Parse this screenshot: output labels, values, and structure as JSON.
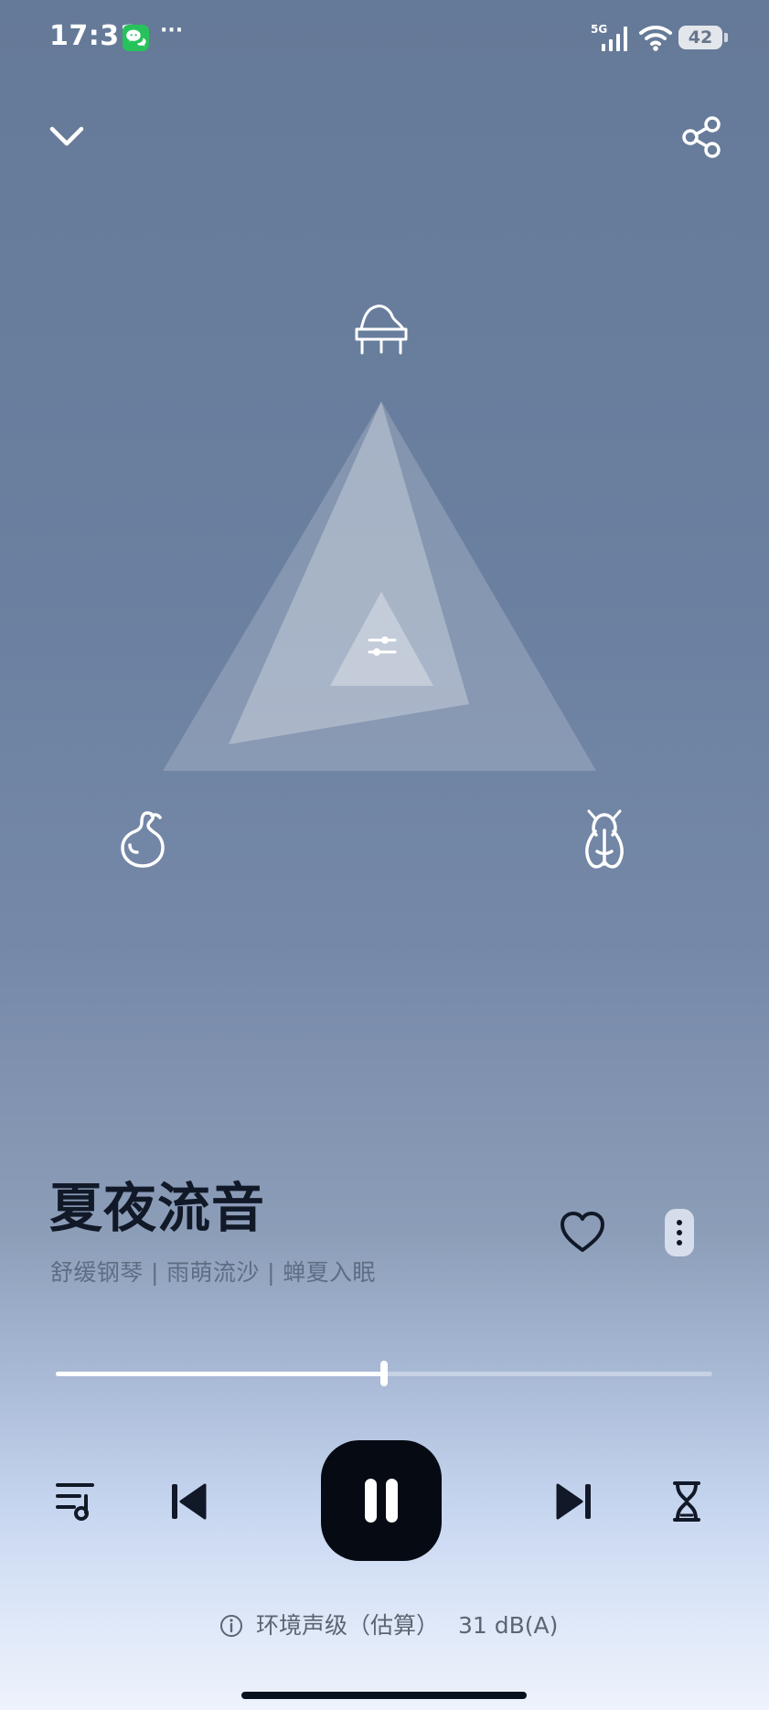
{
  "status_bar": {
    "time": "17:31",
    "app_indicator_icon": "wechat-icon",
    "more_indicator": "···",
    "network": "5G",
    "signal_icon": "signal-icon",
    "wifi_icon": "wifi-icon",
    "battery_level": "42"
  },
  "header": {
    "collapse_icon": "chevron-down-icon",
    "share_icon": "share-icon"
  },
  "sound_mixer": {
    "top_sound_icon": "piano-icon",
    "left_sound_icon": "gourd-icon",
    "right_sound_icon": "cicada-icon",
    "center_control_icon": "sliders-icon"
  },
  "track": {
    "title": "夏夜流音",
    "subtitle": "舒缓钢琴 | 雨萌流沙 | 蝉夏入眠",
    "favorite_icon": "heart-outline-icon",
    "more_icon": "vertical-dots-icon"
  },
  "player": {
    "progress_fraction": 0.5,
    "playlist_icon": "playlist-icon",
    "previous_icon": "skip-previous-icon",
    "pause_icon": "pause-icon",
    "next_icon": "skip-next-icon",
    "timer_icon": "hourglass-icon"
  },
  "ambient": {
    "info_icon": "info-icon",
    "label": "环境声级（估算）",
    "value": "31 dB(A)"
  },
  "colors": {
    "background_top": "#657a98",
    "background_bottom": "#eef3fc",
    "primary_text": "#111827",
    "secondary_text": "#5e6d84",
    "pause_button": "#050a13"
  }
}
